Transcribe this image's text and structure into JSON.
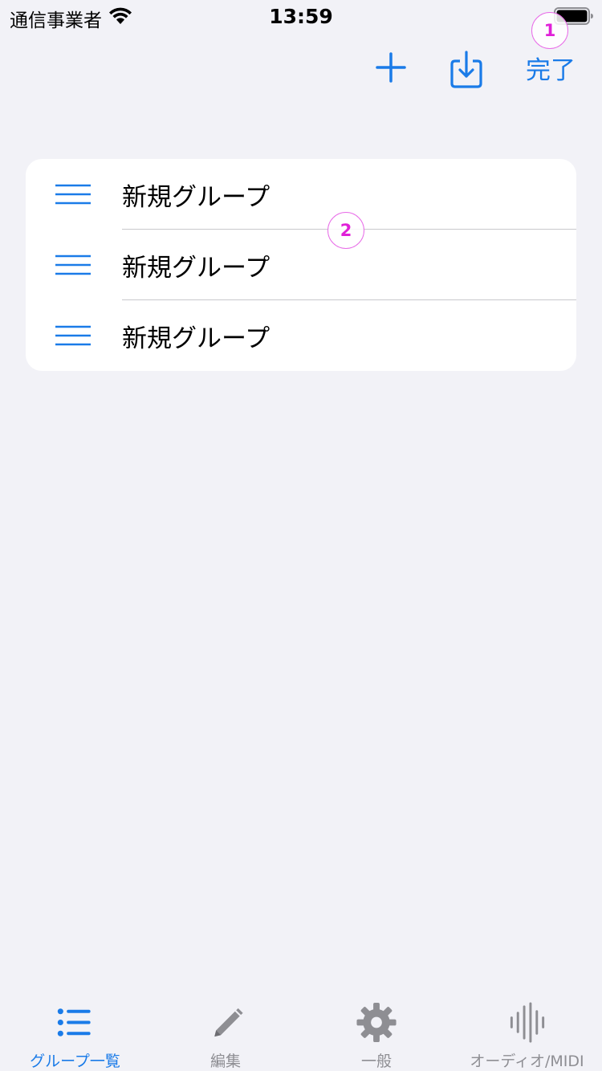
{
  "status_bar": {
    "carrier": "通信事業者",
    "time": "13:59"
  },
  "nav": {
    "done_label": "完了"
  },
  "callouts": [
    "1",
    "2"
  ],
  "groups": [
    {
      "label": "新規グループ"
    },
    {
      "label": "新規グループ"
    },
    {
      "label": "新規グループ"
    }
  ],
  "tabs": [
    {
      "label": "グループ一覧",
      "active": true
    },
    {
      "label": "編集",
      "active": false
    },
    {
      "label": "一般",
      "active": false
    },
    {
      "label": "オーディオ/MIDI",
      "active": false
    }
  ],
  "colors": {
    "accent": "#1a7be8",
    "inactive": "#8e8e93",
    "background": "#f2f2f7",
    "callout": "#e020d8"
  },
  "icons": {
    "add": "plus-icon",
    "import": "import-icon",
    "handle": "reorder-handle-icon",
    "tab_groups": "list-icon",
    "tab_edit": "pencil-icon",
    "tab_general": "gear-icon",
    "tab_audio": "waveform-icon"
  }
}
